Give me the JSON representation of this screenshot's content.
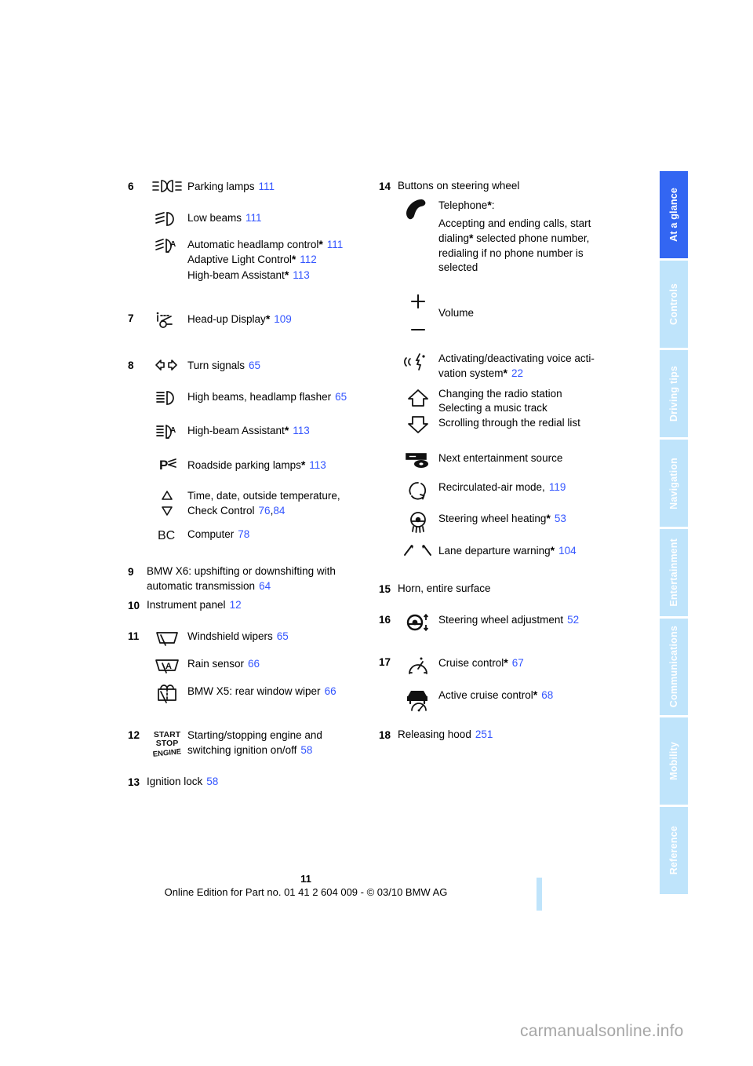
{
  "document": {
    "page_number": "11",
    "edition_line": "Online Edition for Part no. 01 41 2 604 009 - © 03/10 BMW AG",
    "watermark": "carmanualsonline.info"
  },
  "sidebar": {
    "tabs": [
      {
        "label": "At a glance",
        "active": true
      },
      {
        "label": "Controls",
        "active": false
      },
      {
        "label": "Driving tips",
        "active": false
      },
      {
        "label": "Navigation",
        "active": false
      },
      {
        "label": "Entertainment",
        "active": false
      },
      {
        "label": "Communications",
        "active": false
      },
      {
        "label": "Mobility",
        "active": false
      },
      {
        "label": "Reference",
        "active": false
      }
    ]
  },
  "left_column": {
    "item6": {
      "number": "6",
      "rows": [
        {
          "icon": "parking-lamps-icon",
          "text": "Parking lamps",
          "ref": "111"
        },
        {
          "icon": "low-beams-icon",
          "text": "Low beams",
          "ref": "111"
        }
      ],
      "auto_headlamp": {
        "icon": "automatic-headlamp-control-icon",
        "line1_text": "Automatic headlamp control",
        "line1_ref": "111",
        "line2_text": "Adaptive Light Control",
        "line2_ref": "112",
        "line3_text": "High-beam Assistant",
        "line3_ref": "113"
      }
    },
    "item7": {
      "number": "7",
      "icon": "head-up-display-icon",
      "text": "Head-up Display",
      "ref": "109"
    },
    "item8": {
      "number": "8",
      "rows": [
        {
          "icon": "turn-signals-icon",
          "text": "Turn signals",
          "ref": "65",
          "star": false
        },
        {
          "icon": "high-beams-icon",
          "text": "High beams, headlamp flasher",
          "ref": "65",
          "star": false
        },
        {
          "icon": "high-beam-assistant-icon",
          "text": "High-beam Assistant",
          "ref": "113",
          "star": true
        },
        {
          "icon": "roadside-parking-lamps-icon",
          "text": "Roadside parking lamps",
          "ref": "113",
          "star": true
        }
      ],
      "check_control": {
        "icon": "up-down-arrows-icon",
        "line1": "Time, date, outside temperature,",
        "line2": "Check Control",
        "ref1": "76",
        "ref2": "84"
      },
      "computer": {
        "icon": "bc-computer-icon",
        "text": "Computer",
        "ref": "78"
      }
    },
    "item9": {
      "number": "9",
      "line1": "BMW X6: upshifting or downshifting with",
      "line2": "automatic transmission",
      "ref": "64"
    },
    "item10": {
      "number": "10",
      "text": "Instrument panel",
      "ref": "12"
    },
    "item11": {
      "number": "11",
      "rows": [
        {
          "icon": "windshield-wipers-icon",
          "text": "Windshield wipers",
          "ref": "65"
        },
        {
          "icon": "rain-sensor-icon",
          "text": "Rain sensor",
          "ref": "66"
        },
        {
          "icon": "rear-window-wiper-icon",
          "text": "BMW X5: rear window wiper",
          "ref": "66"
        }
      ]
    },
    "item12": {
      "number": "12",
      "icon": "start-stop-engine-icon",
      "line1": "Starting/stopping engine and",
      "line2": "switching ignition on/off",
      "ref": "58"
    },
    "item13": {
      "number": "13",
      "text": "Ignition lock",
      "ref": "58"
    }
  },
  "right_column": {
    "item14": {
      "number": "14",
      "heading": "Buttons on steering wheel",
      "telephone": {
        "icon": "telephone-handset-icon",
        "title": "Telephone",
        "title_suffix": ":",
        "body_line1": "Accepting and ending calls, start",
        "body_line2_pre": "dialing",
        "body_line2_post": " selected phone number,",
        "body_line3": "redialing if no phone number is",
        "body_line4": "selected"
      },
      "volume": {
        "icon_plus": "plus-icon",
        "icon_minus": "minus-icon",
        "text": "Volume"
      },
      "voice": {
        "icon": "voice-activation-icon",
        "line1": "Activating/deactivating voice acti-",
        "line2": "vation system",
        "ref": "22"
      },
      "updown": {
        "icon_up": "arrow-up-icon",
        "icon_down": "arrow-down-icon",
        "line1": "Changing the radio station",
        "line2": "Selecting a music track",
        "line3": "Scrolling through the redial list"
      },
      "entertainment": {
        "icon": "entertainment-source-icon",
        "text": "Next entertainment source"
      },
      "recirculated": {
        "icon": "recirculated-air-icon",
        "text": "Recirculated-air mode,",
        "ref": "119"
      },
      "wheel_heating": {
        "icon": "steering-wheel-heating-icon",
        "text": "Steering wheel heating",
        "ref": "53"
      },
      "lane_departure": {
        "icon": "lane-departure-warning-icon",
        "text": "Lane departure warning",
        "ref": "104"
      }
    },
    "item15": {
      "number": "15",
      "text": "Horn, entire surface"
    },
    "item16": {
      "number": "16",
      "icon": "steering-wheel-adjustment-icon",
      "text": "Steering wheel adjustment",
      "ref": "52"
    },
    "item17": {
      "number": "17",
      "rows": [
        {
          "icon": "cruise-control-icon",
          "text": "Cruise control",
          "ref": "67"
        },
        {
          "icon": "active-cruise-control-icon",
          "text": "Active cruise control",
          "ref": "68"
        }
      ]
    },
    "item18": {
      "number": "18",
      "text": "Releasing hood",
      "ref": "251"
    }
  }
}
